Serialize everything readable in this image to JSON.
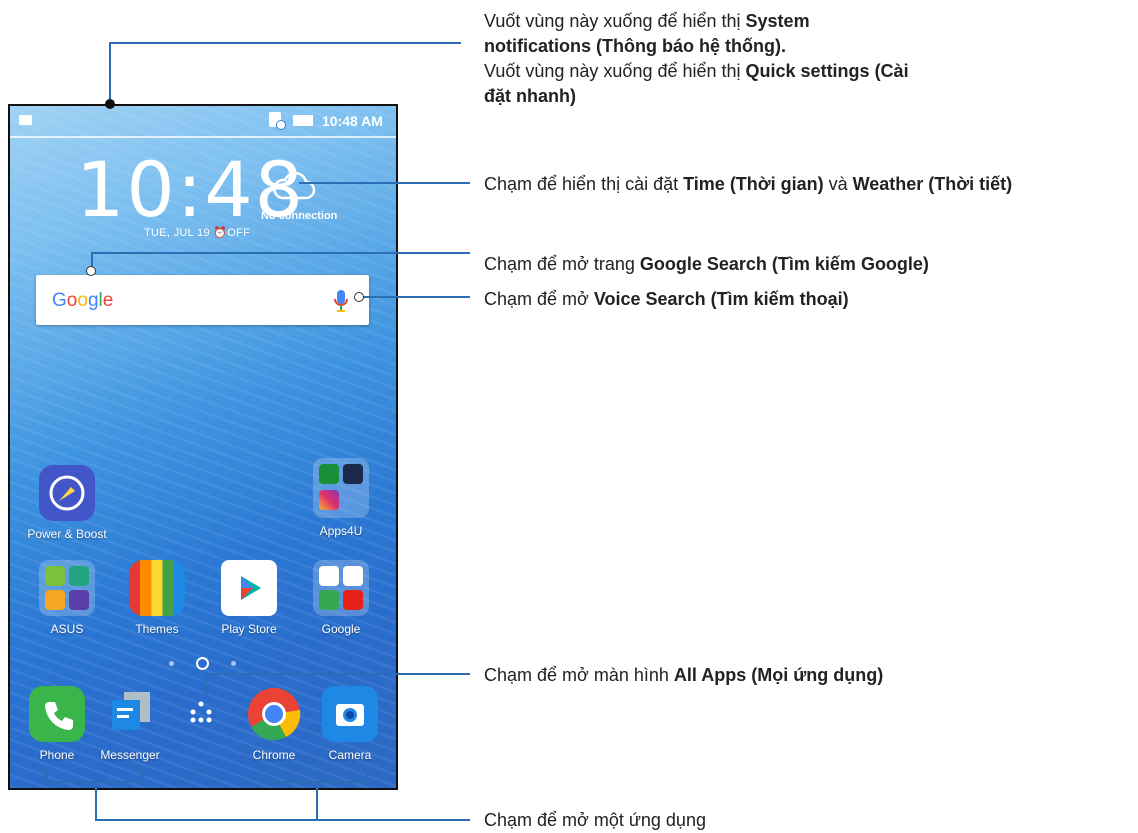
{
  "status_bar": {
    "time": "10:48 AM"
  },
  "lock_widget": {
    "clock": "10:48",
    "date": "TUE, JUL 19",
    "alarm": "OFF",
    "weather": "No connection"
  },
  "search_bar": {
    "logo": "Google"
  },
  "apps": {
    "power_boost": "Power & Boost",
    "apps4u": "Apps4U",
    "asus": "ASUS",
    "themes": "Themes",
    "play_store": "Play Store",
    "google": "Google"
  },
  "dock": {
    "phone": "Phone",
    "messenger": "Messenger",
    "chrome": "Chrome",
    "camera": "Camera"
  },
  "annotations": {
    "a1_line1_pre": "Vuốt vùng này xuống để hiển thị ",
    "a1_line1_bold": "System",
    "a1_line2_bold": "notifications (Thông báo hệ thống).",
    "a1_line3_pre": "Vuốt vùng này xuống để hiển thị ",
    "a1_line3_bold": "Quick settings (Cài",
    "a1_line4_bold": "đặt nhanh)",
    "a2_pre": "Chạm để hiển thị cài đặt ",
    "a2_bold1": "Time (Thời gian)",
    "a2_mid": " và ",
    "a2_bold2": "Weather (Thời tiết)",
    "a3_pre": "Chạm để mở trang ",
    "a3_bold": "Google Search (Tìm kiếm Google)",
    "a4_pre": "Chạm để mở ",
    "a4_bold": "Voice Search (Tìm kiếm thoại)",
    "a5_pre": "Chạm để mở màn hình ",
    "a5_bold": "All Apps (Mọi ứng dụng)",
    "a6": "Chạm để mở một ứng dụng"
  },
  "colors": {
    "callout_line": "#2a6fb5",
    "google_blue": "#4285F4",
    "google_red": "#EA4335",
    "google_yellow": "#FBBC05",
    "google_green": "#34A853"
  }
}
